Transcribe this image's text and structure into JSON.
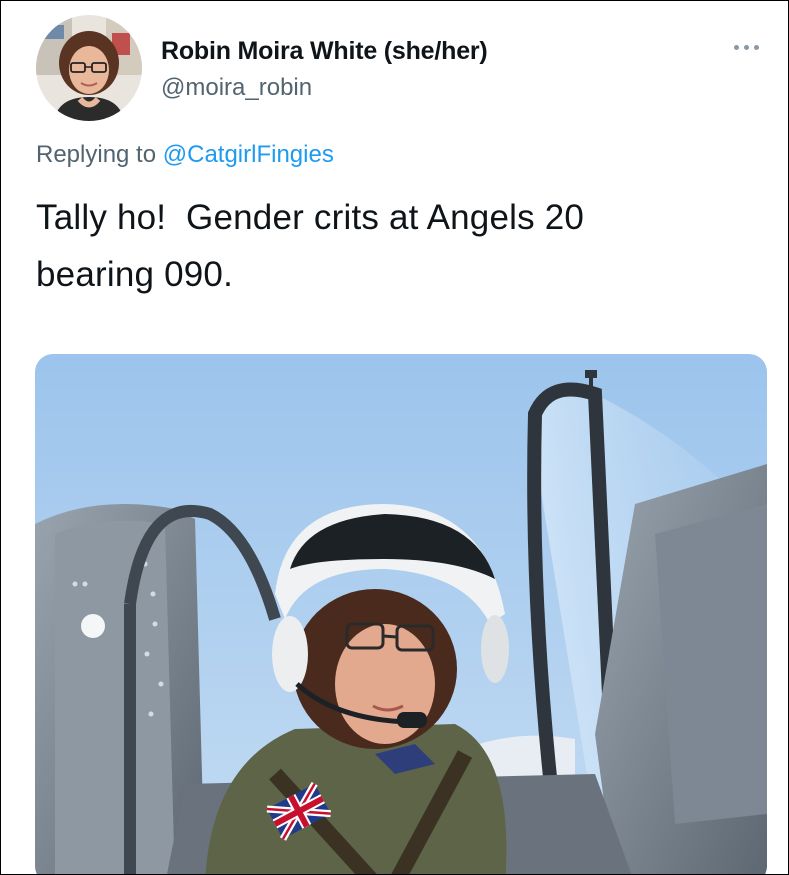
{
  "tweet": {
    "author": {
      "display_name": "Robin Moira White (she/her)",
      "handle": "@moira_robin",
      "avatar_icon": "profile-photo"
    },
    "more_icon": "more-options-icon",
    "reply": {
      "prefix": "Replying to ",
      "mention": "@CatgirlFingies"
    },
    "text_line_1": "Tally ho!  Gender crits at Angels 20",
    "text_line_2": "bearing 090.",
    "media": {
      "type": "photo",
      "flag_icon": "union-jack-patch"
    }
  },
  "colors": {
    "text": "#0f1419",
    "secondary": "#536471",
    "link": "#1d9bf0",
    "sky": "#a9cdef"
  }
}
